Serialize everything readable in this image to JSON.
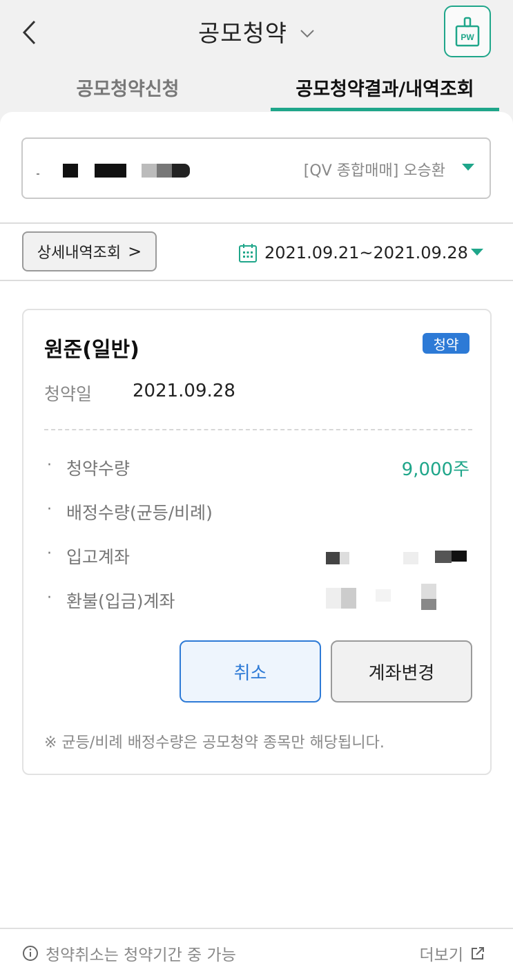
{
  "header": {
    "title": "공모청약"
  },
  "tabs": [
    {
      "label": "공모청약신청",
      "active": false
    },
    {
      "label": "공모청약결과/내역조회",
      "active": true
    }
  ],
  "account": {
    "name": "[QV 종합매매] 오승환"
  },
  "filter": {
    "detail_label": "상세내역조회",
    "detail_chevron": ">",
    "date_range": "2021.09.21~2021.09.28"
  },
  "card": {
    "stock_name": "원준(일반)",
    "badge": "청약",
    "subscription_date_label": "청약일",
    "subscription_date_value": "2021.09.28",
    "rows": [
      {
        "label": "청약수량",
        "value": "9,000주"
      },
      {
        "label": "배정수량(균등/비례)",
        "value": ""
      },
      {
        "label": "입고계좌",
        "value": ""
      },
      {
        "label": "환불(입금)계좌",
        "value": ""
      }
    ],
    "cancel_button": "취소",
    "change_account_button": "계좌변경",
    "note": "※ 균등/비례 배정수량은 공모청약 종목만 해당됩니다."
  },
  "footer": {
    "info_text": "청약취소는 청약기간 중 가능",
    "more_label": "더보기"
  },
  "colors": {
    "accent": "#1fa68a",
    "badge_blue": "#2d7ad6",
    "background": "#f1f1f1"
  },
  "icons": {
    "back": "back-arrow-icon",
    "title_dropdown": "chevron-down-icon",
    "password": "pw-lock-icon",
    "calendar": "calendar-icon",
    "info": "info-icon",
    "external": "external-link-icon"
  }
}
